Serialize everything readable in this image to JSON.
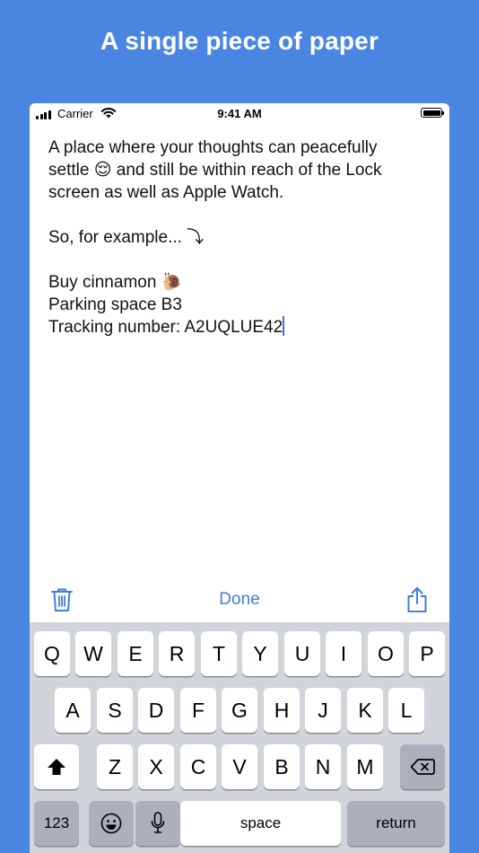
{
  "headline": "A single piece of paper",
  "status_bar": {
    "carrier": "Carrier",
    "time": "9:41 AM"
  },
  "note": {
    "lines": [
      "A place where your thoughts can peacefully",
      "settle 😌 and still be within reach of the Lock",
      "screen as well as Apple Watch.",
      "",
      "So, for example... ⤵",
      "",
      "Buy cinnamon 🐌",
      "Parking space B3",
      "Tracking number: A2UQLUE42"
    ]
  },
  "toolbar": {
    "done_label": "Done",
    "trash_icon": "trash-icon",
    "share_icon": "share-icon"
  },
  "keyboard": {
    "row1": [
      "Q",
      "W",
      "E",
      "R",
      "T",
      "Y",
      "U",
      "I",
      "O",
      "P"
    ],
    "row2": [
      "A",
      "S",
      "D",
      "F",
      "G",
      "H",
      "J",
      "K",
      "L"
    ],
    "row3": [
      "Z",
      "X",
      "C",
      "V",
      "B",
      "N",
      "M"
    ],
    "numbers_label": "123",
    "space_label": "space",
    "return_label": "return"
  },
  "colors": {
    "background": "#4A86E1",
    "accent": "#3F7FD9",
    "keyboard_bg": "#D1D4D9"
  }
}
